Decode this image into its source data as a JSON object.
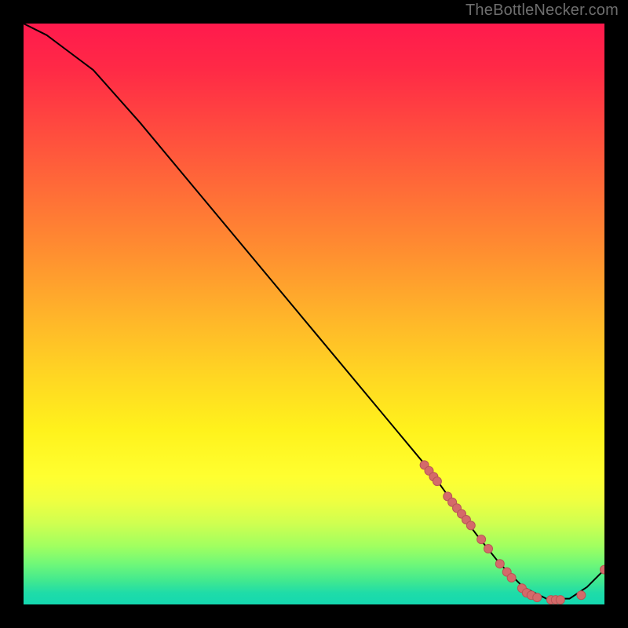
{
  "watermark": "TheBottleNecker.com",
  "chart_data": {
    "type": "line",
    "title": "",
    "xlabel": "",
    "ylabel": "",
    "xlim": [
      0,
      100
    ],
    "ylim": [
      0,
      100
    ],
    "series": [
      {
        "name": "curve",
        "x": [
          0,
          4,
          8,
          12,
          20,
          30,
          40,
          50,
          60,
          70,
          75,
          78,
          82,
          86,
          90,
          94,
          97,
          100
        ],
        "y": [
          100,
          98,
          95,
          92,
          83,
          71,
          59,
          47,
          35,
          23,
          16,
          12,
          7,
          3,
          1,
          1,
          3,
          6
        ]
      }
    ],
    "markers": {
      "name": "red-dots",
      "x": [
        69.0,
        69.8,
        70.6,
        71.2,
        73.0,
        73.8,
        74.6,
        75.4,
        76.2,
        77.0,
        78.8,
        80.0,
        82.0,
        83.2,
        84.0,
        85.8,
        86.6,
        87.4,
        88.4,
        90.8,
        91.6,
        92.4,
        96.0,
        100.0
      ],
      "y": [
        24.0,
        23.0,
        22.0,
        21.2,
        18.6,
        17.6,
        16.6,
        15.6,
        14.6,
        13.6,
        11.2,
        9.6,
        7.0,
        5.6,
        4.6,
        2.8,
        2.0,
        1.6,
        1.2,
        0.8,
        0.8,
        0.8,
        1.6,
        6.0
      ]
    },
    "colors": {
      "line": "#000000",
      "marker_fill": "#d46a6a",
      "marker_stroke": "#b85656"
    }
  }
}
